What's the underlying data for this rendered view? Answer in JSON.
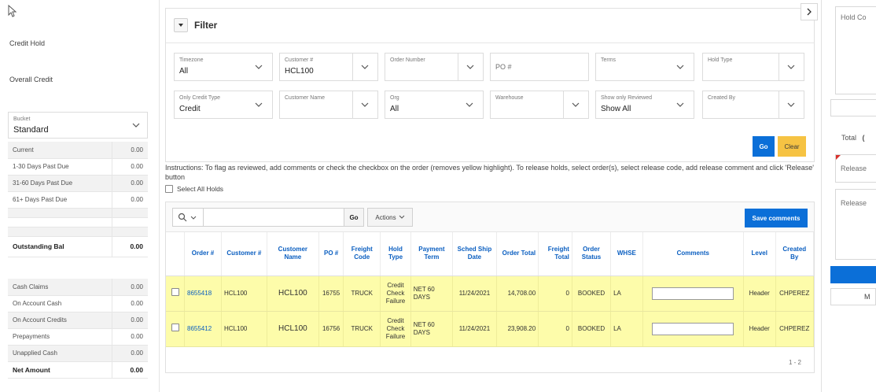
{
  "left": {
    "credit_hold_label": "Credit Hold",
    "overall_credit_label": "Overall Credit",
    "bucket": {
      "label": "Bucket",
      "value": "Standard"
    },
    "aging": [
      {
        "label": "Current",
        "value": "0.00"
      },
      {
        "label": "1-30 Days Past Due",
        "value": "0.00"
      },
      {
        "label": "31-60 Days Past Due",
        "value": "0.00"
      },
      {
        "label": "61+ Days Past Due",
        "value": "0.00"
      }
    ],
    "outstanding": {
      "label": "Outstanding Bal",
      "value": "0.00"
    },
    "cash": [
      {
        "label": "Cash Claims",
        "value": "0.00"
      },
      {
        "label": "On Account Cash",
        "value": "0.00"
      },
      {
        "label": "On Account Credits",
        "value": "0.00"
      },
      {
        "label": "Prepayments",
        "value": "0.00"
      },
      {
        "label": "Unapplied Cash",
        "value": "0.00"
      }
    ],
    "net": {
      "label": "Net Amount",
      "value": "0.00"
    }
  },
  "filter": {
    "title": "Filter",
    "fields": {
      "timezone": {
        "label": "Timezone",
        "value": "All"
      },
      "customer_num": {
        "label": "Customer #",
        "value": "HCL100"
      },
      "order_number": {
        "label": "Order Number"
      },
      "po": {
        "placeholder": "PO #"
      },
      "terms": {
        "label": "Terms"
      },
      "hold_type": {
        "label": "Hold Type"
      },
      "credit_type": {
        "label": "Only Credit Type",
        "value": "Credit"
      },
      "customer_name": {
        "label": "Customer Name"
      },
      "org": {
        "label": "Org",
        "value": "All"
      },
      "warehouse": {
        "label": "Warehouse"
      },
      "reviewed": {
        "label": "Show only Reviewed",
        "value": "Show All"
      },
      "created_by": {
        "label": "Created By"
      }
    },
    "go_label": "Go",
    "clear_label": "Clear"
  },
  "instructions": "Instructions: To flag as reviewed, add comments or check the checkbox on the order (removes yellow highlight). To release holds, select order(s), select release code, add release comment and click 'Release' button",
  "select_all_label": "Select All Holds",
  "report": {
    "go_label": "Go",
    "actions_label": "Actions",
    "save_label": "Save comments",
    "columns": {
      "order": "Order #",
      "cust_num": "Customer #",
      "cust_name": "Customer Name",
      "po": "PO #",
      "freight_code": "Freight Code",
      "hold_type": "Hold Type",
      "payment_term": "Payment Term",
      "sched_ship": "Sched Ship Date",
      "order_total": "Order Total",
      "freight_total": "Freight Total",
      "order_status": "Order Status",
      "whse": "WHSE",
      "comments": "Comments",
      "level": "Level",
      "created_by": "Created By"
    },
    "rows": [
      {
        "order": "8655418",
        "cust_num": "HCL100",
        "cust_name": "HCL100",
        "po": "16755",
        "freight_code": "TRUCK",
        "hold_type": "Credit Check Failure",
        "payment_term": "NET 60 DAYS",
        "sched_ship": "11/24/2021",
        "order_total": "14,708.00",
        "freight_total": "0",
        "order_status": "BOOKED",
        "whse": "LA",
        "level": "Header",
        "created_by": "CHPEREZ"
      },
      {
        "order": "8655412",
        "cust_num": "HCL100",
        "cust_name": "HCL100",
        "po": "16756",
        "freight_code": "TRUCK",
        "hold_type": "Credit Check Failure",
        "payment_term": "NET 60 DAYS",
        "sched_ship": "11/24/2021",
        "order_total": "23,908.20",
        "freight_total": "0",
        "order_status": "BOOKED",
        "whse": "LA",
        "level": "Header",
        "created_by": "CHPEREZ"
      }
    ],
    "pagination": "1 - 2"
  },
  "right": {
    "hold_code_label": "Hold Co",
    "total_label": "Total",
    "total_value": "(",
    "release_code_label": "Release",
    "release_comment_label": "Release",
    "more_label": "M"
  },
  "colors": {
    "primary": "#0b6fd8",
    "clear": "#f6c343",
    "row_highlight": "#fdfcaa",
    "link": "#0a5ec0"
  }
}
